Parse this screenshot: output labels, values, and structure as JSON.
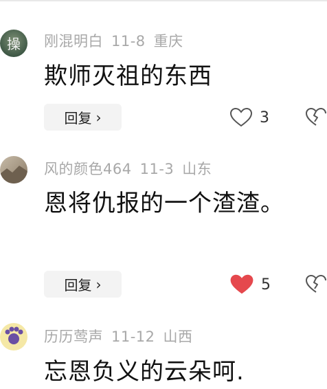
{
  "comments": [
    {
      "username": "刚混明白",
      "date": "11-8",
      "location": "重庆",
      "text": "欺师灭祖的东西",
      "reply_label": "回复",
      "reply_chevron": "›",
      "like_count": "3",
      "liked": false,
      "avatar_char": "操",
      "avatar_colors": [
        "#2f4a3a",
        "#7c8f74"
      ]
    },
    {
      "username": "风的颜色464",
      "date": "11-3",
      "location": "山东",
      "text": "恩将仇报的一个渣渣。",
      "reply_label": "回复",
      "reply_chevron": "›",
      "like_count": "5",
      "liked": true,
      "avatar_colors": [
        "#8a7a66",
        "#c7bba8"
      ]
    },
    {
      "username": "历历莺声",
      "date": "11-12",
      "location": "山西",
      "text": "忘恩负义的云朵呵.",
      "avatar_colors": [
        "#f5e8a6",
        "#6a4fa3"
      ]
    }
  ],
  "colors": {
    "like_active": "#e5484d",
    "meta_gray": "#a8a8a8",
    "button_bg": "#f3f3f3"
  },
  "icons": {
    "like": "heart-icon",
    "dislike": "broken-heart-icon",
    "reply": "chevron-right-icon"
  }
}
